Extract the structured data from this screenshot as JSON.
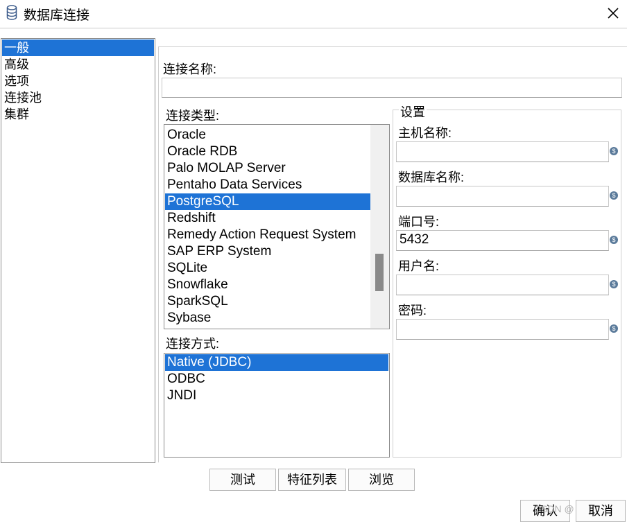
{
  "window": {
    "title": "数据库连接"
  },
  "nav": {
    "items": [
      "一般",
      "高级",
      "选项",
      "连接池",
      "集群"
    ],
    "selected": 0
  },
  "connection_name": {
    "label": "连接名称:",
    "value": ""
  },
  "connection_type": {
    "label": "连接类型:",
    "items": [
      "Oracle",
      "Oracle RDB",
      "Palo MOLAP Server",
      "Pentaho Data Services",
      "PostgreSQL",
      "Redshift",
      "Remedy Action Request System",
      "SAP ERP System",
      "SQLite",
      "Snowflake",
      "SparkSQL",
      "Sybase"
    ],
    "selected": 4
  },
  "connection_method": {
    "label": "连接方式:",
    "items": [
      "Native (JDBC)",
      "ODBC",
      "JNDI"
    ],
    "selected": 0
  },
  "settings": {
    "title": "设置",
    "host": {
      "label": "主机名称:",
      "value": ""
    },
    "database": {
      "label": "数据库名称:",
      "value": ""
    },
    "port": {
      "label": "端口号:",
      "value": "5432"
    },
    "username": {
      "label": "用户名:",
      "value": ""
    },
    "password": {
      "label": "密码:",
      "value": ""
    }
  },
  "buttons": {
    "test": "测试",
    "features": "特征列表",
    "browse": "浏览",
    "ok": "确认",
    "cancel": "取消"
  },
  "watermark": "CSDN @"
}
